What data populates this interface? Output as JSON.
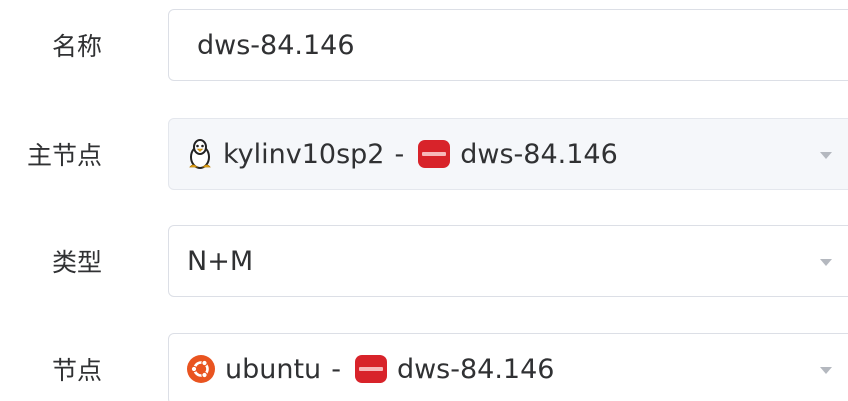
{
  "form": {
    "name": {
      "label": "名称",
      "value": "dws-84.146"
    },
    "master_node": {
      "label": "主节点",
      "os_icon": "linux-penguin-icon",
      "os_name": "kylinv10sp2",
      "separator": "-",
      "db_icon": "gaussdb-icon",
      "db_name": "dws-84.146",
      "disabled": true
    },
    "type": {
      "label": "类型",
      "value": "N+M"
    },
    "node": {
      "label": "节点",
      "os_icon": "ubuntu-icon",
      "os_name": "ubuntu",
      "separator": "-",
      "db_icon": "gaussdb-icon",
      "db_name": "dws-84.146"
    }
  },
  "colors": {
    "border": "#dcdfe6",
    "disabled_bg": "#f5f7fa",
    "text": "#303133",
    "arrow": "#b4b8bf",
    "db_icon_red": "#d8232a",
    "ubuntu_orange": "#e95420"
  }
}
